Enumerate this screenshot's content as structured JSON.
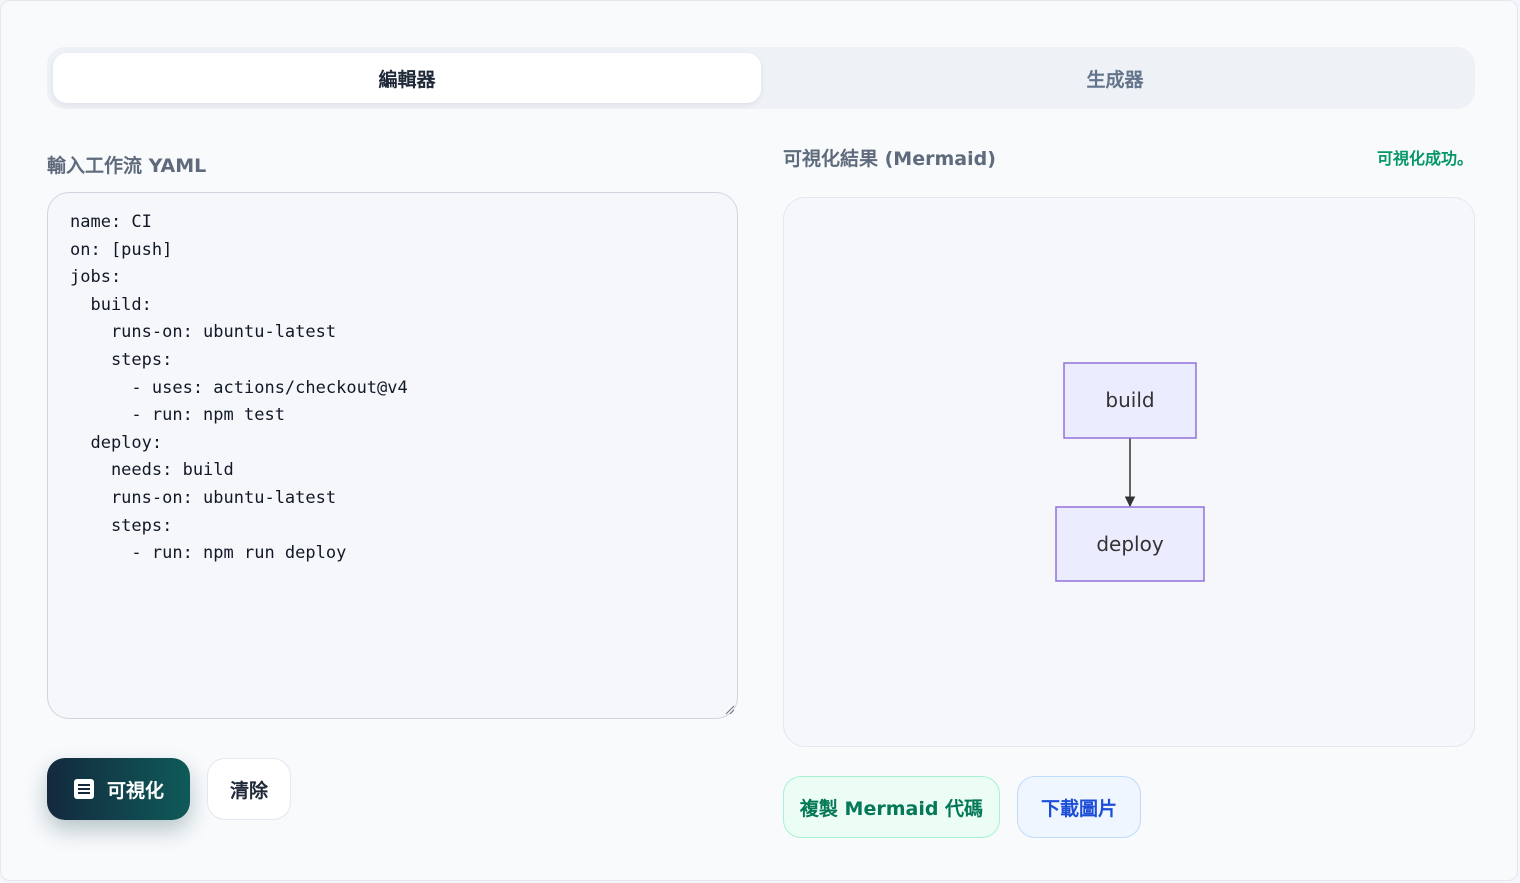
{
  "tabs": [
    {
      "label": "編輯器",
      "active": true
    },
    {
      "label": "生成器",
      "active": false
    }
  ],
  "editor": {
    "label": "輸入工作流 YAML",
    "value": "name: CI\non: [push]\njobs:\n  build:\n    runs-on: ubuntu-latest\n    steps:\n      - uses: actions/checkout@v4\n      - run: npm test\n  deploy:\n    needs: build\n    runs-on: ubuntu-latest\n    steps:\n      - run: npm run deploy"
  },
  "preview": {
    "label": "可視化結果 (Mermaid)",
    "status": "可視化成功。",
    "status_color": "#059669",
    "nodes": [
      "build",
      "deploy"
    ],
    "edges": [
      [
        "build",
        "deploy"
      ]
    ],
    "node_fill": "#ECECFF",
    "node_stroke": "#9370DB"
  },
  "actions": {
    "visualize_label": "可視化",
    "visualize_icon": "document-list-icon",
    "clear_label": "清除",
    "copy_label": "複製 Mermaid 代碼",
    "download_label": "下載圖片"
  }
}
